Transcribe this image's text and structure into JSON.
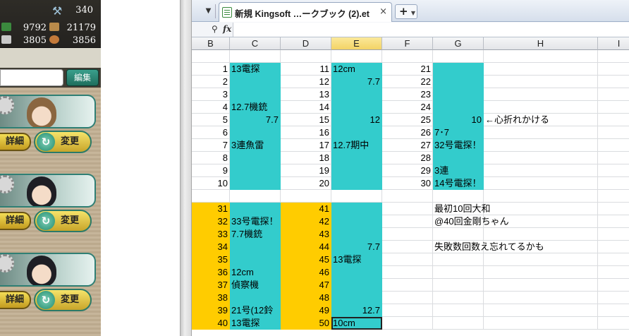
{
  "game": {
    "resources": {
      "top": "340",
      "fuel": "9792",
      "ammo": "21179",
      "steel": "3805",
      "bauxite": "3856"
    },
    "edit_label": "編集",
    "cards": [
      {
        "detail_label": "詳細",
        "change_label": "変更"
      },
      {
        "detail_label": "詳細",
        "change_label": "変更"
      },
      {
        "detail_label": "詳細",
        "change_label": "変更"
      }
    ]
  },
  "spreadsheet": {
    "tab_title": "新規 Kingsoft …ークブック (2).et",
    "close_glyph": "×",
    "new_tab_glyph": "+",
    "columns": [
      "B",
      "C",
      "D",
      "E",
      "F",
      "G",
      "H",
      "I"
    ],
    "selected_column": "E",
    "rows": [
      {
        "B": "",
        "C": "",
        "D": "",
        "E": "",
        "F": "",
        "G": "",
        "H": ""
      },
      {
        "B": "1",
        "C": "13電探",
        "D": "11",
        "E": "12cm",
        "F": "21",
        "G": "",
        "H": ""
      },
      {
        "B": "2",
        "C": "",
        "D": "12",
        "E": "7.7",
        "F": "22",
        "G": "",
        "H": ""
      },
      {
        "B": "3",
        "C": "",
        "D": "13",
        "E": "",
        "F": "23",
        "G": "",
        "H": ""
      },
      {
        "B": "4",
        "C": "12.7機銃",
        "D": "14",
        "E": "",
        "F": "24",
        "G": "",
        "H": ""
      },
      {
        "B": "5",
        "C": "7.7",
        "D": "15",
        "E": "12",
        "F": "25",
        "G": "10",
        "H": "←心折れかける"
      },
      {
        "B": "6",
        "C": "",
        "D": "16",
        "E": "",
        "F": "26",
        "G": "7･7",
        "H": ""
      },
      {
        "B": "7",
        "C": "3連魚雷",
        "D": "17",
        "E": "12.7期中",
        "F": "27",
        "G": "32号電探！",
        "H": ""
      },
      {
        "B": "8",
        "C": "",
        "D": "18",
        "E": "",
        "F": "28",
        "G": "",
        "H": ""
      },
      {
        "B": "9",
        "C": "",
        "D": "19",
        "E": "",
        "F": "29",
        "G": "3連",
        "H": ""
      },
      {
        "B": "10",
        "C": "",
        "D": "20",
        "E": "",
        "F": "30",
        "G": "14号電探！",
        "H": ""
      },
      {
        "B": "",
        "C": "",
        "D": "",
        "E": "",
        "F": "",
        "G": "",
        "H": ""
      },
      {
        "B": "31",
        "C": "",
        "D": "41",
        "E": "",
        "F": "",
        "G": "最初10回大和",
        "H": ""
      },
      {
        "B": "32",
        "C": "33号電探！",
        "D": "42",
        "E": "",
        "F": "",
        "G": "@40回金剛ちゃん",
        "H": ""
      },
      {
        "B": "33",
        "C": "7.7機銃",
        "D": "43",
        "E": "",
        "F": "",
        "G": "",
        "H": ""
      },
      {
        "B": "34",
        "C": "",
        "D": "44",
        "E": "7.7",
        "F": "",
        "G": "失敗数回数え忘れてるかも",
        "H": ""
      },
      {
        "B": "35",
        "C": "",
        "D": "45",
        "E": "13電探",
        "F": "",
        "G": "",
        "H": ""
      },
      {
        "B": "36",
        "C": "12cm",
        "D": "46",
        "E": "",
        "F": "",
        "G": "",
        "H": ""
      },
      {
        "B": "37",
        "C": "偵察機",
        "D": "47",
        "E": "",
        "F": "",
        "G": "",
        "H": ""
      },
      {
        "B": "38",
        "C": "",
        "D": "48",
        "E": "",
        "F": "",
        "G": "",
        "H": ""
      },
      {
        "B": "39",
        "C": "21号(12鈴",
        "D": "49",
        "E": "12.7",
        "F": "",
        "G": "",
        "H": ""
      },
      {
        "B": "40",
        "C": "13電探",
        "D": "50",
        "E": "10cm",
        "F": "",
        "G": "",
        "H": ""
      }
    ],
    "colors": {
      "cyan": "#33cccc",
      "gold": "#ffcc00",
      "selected_header": "#f3d365"
    }
  }
}
